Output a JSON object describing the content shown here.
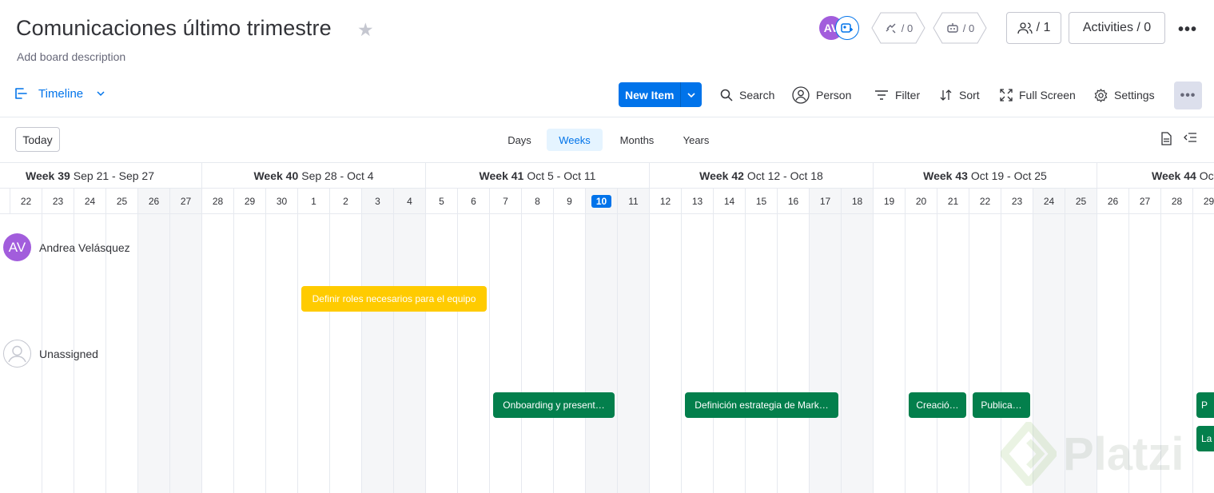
{
  "header": {
    "title": "Comunicaciones último trimestre",
    "description": "Add board description",
    "avatar_initials": "AV",
    "integrations_count": "/ 0",
    "automations_count": "/ 0",
    "members_label": "/ 1",
    "activities_label": "Activities / 0"
  },
  "toolbar": {
    "view_label": "Timeline",
    "new_item_label": "New Item",
    "search_label": "Search",
    "person_label": "Person",
    "filter_label": "Filter",
    "sort_label": "Sort",
    "fullscreen_label": "Full Screen",
    "settings_label": "Settings"
  },
  "controls": {
    "today_label": "Today",
    "scales": [
      {
        "label": "Days",
        "active": false
      },
      {
        "label": "Weeks",
        "active": true
      },
      {
        "label": "Months",
        "active": false
      },
      {
        "label": "Years",
        "active": false
      }
    ]
  },
  "timeline": {
    "weeks": [
      {
        "week": "Week 39",
        "range": "Sep 21 - Sep 27"
      },
      {
        "week": "Week 40",
        "range": "Sep 28 - Oct 4"
      },
      {
        "week": "Week 41",
        "range": "Oct 5 - Oct 11"
      },
      {
        "week": "Week 42",
        "range": "Oct 12 - Oct 18"
      },
      {
        "week": "Week 43",
        "range": "Oct 19 - Oct 25"
      },
      {
        "week": "Week 44",
        "range": "Oct"
      }
    ],
    "days": [
      "22",
      "23",
      "24",
      "25",
      "26",
      "27",
      "28",
      "29",
      "30",
      "1",
      "2",
      "3",
      "4",
      "5",
      "6",
      "7",
      "8",
      "9",
      "10",
      "11",
      "12",
      "13",
      "14",
      "15",
      "16",
      "17",
      "18",
      "19",
      "20",
      "21",
      "22",
      "23",
      "24",
      "25",
      "26",
      "27",
      "28",
      "29"
    ],
    "today_day": "10",
    "groups": [
      {
        "name": "Andrea Velásquez",
        "initials": "AV"
      },
      {
        "name": "Unassigned",
        "initials": ""
      }
    ],
    "items": [
      {
        "label": "Definir roles necesarios para el equipo",
        "color": "#ffcb00"
      },
      {
        "label": "Onboarding y present…",
        "color": "#037f4c"
      },
      {
        "label": "Definición estrategia de Mark…",
        "color": "#037f4c"
      },
      {
        "label": "Creació…",
        "color": "#037f4c"
      },
      {
        "label": "Publica…",
        "color": "#037f4c"
      },
      {
        "label": "P",
        "color": "#037f4c"
      },
      {
        "label": "La",
        "color": "#037f4c"
      }
    ]
  },
  "watermark": "Platzi",
  "colors": {
    "accent": "#0073ea",
    "yellow": "#ffcb00",
    "green": "#037f4c",
    "avatar_purple": "#a25ddc"
  }
}
